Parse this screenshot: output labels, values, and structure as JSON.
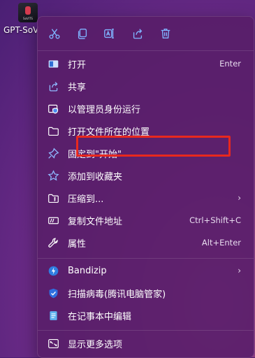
{
  "desktop": {
    "icon_label": "GPT-SoV",
    "icon_tiny_text": "SoVITS"
  },
  "toolbar": {
    "cut": "cut-icon",
    "copy": "copy-icon",
    "rename": "rename-icon",
    "share": "share-icon",
    "delete": "delete-icon"
  },
  "menu": {
    "items": [
      {
        "label": "打开",
        "shortcut": "Enter"
      },
      {
        "label": "共享",
        "shortcut": ""
      },
      {
        "label": "以管理员身份运行",
        "shortcut": ""
      },
      {
        "label": "打开文件所在的位置",
        "shortcut": ""
      },
      {
        "label": "固定到\"开始\"",
        "shortcut": ""
      },
      {
        "label": "添加到收藏夹",
        "shortcut": ""
      },
      {
        "label": "压缩到...",
        "shortcut": ""
      },
      {
        "label": "复制文件地址",
        "shortcut": "Ctrl+Shift+C"
      },
      {
        "label": "属性",
        "shortcut": "Alt+Enter"
      },
      {
        "label": "Bandizip",
        "shortcut": ""
      },
      {
        "label": "扫描病毒(腾讯电脑管家)",
        "shortcut": ""
      },
      {
        "label": "在记事本中编辑",
        "shortcut": ""
      },
      {
        "label": "显示更多选项",
        "shortcut": ""
      }
    ],
    "submenu_arrow": "›",
    "highlight_color": "#e8281e",
    "accent_color": "#8fbaff"
  }
}
